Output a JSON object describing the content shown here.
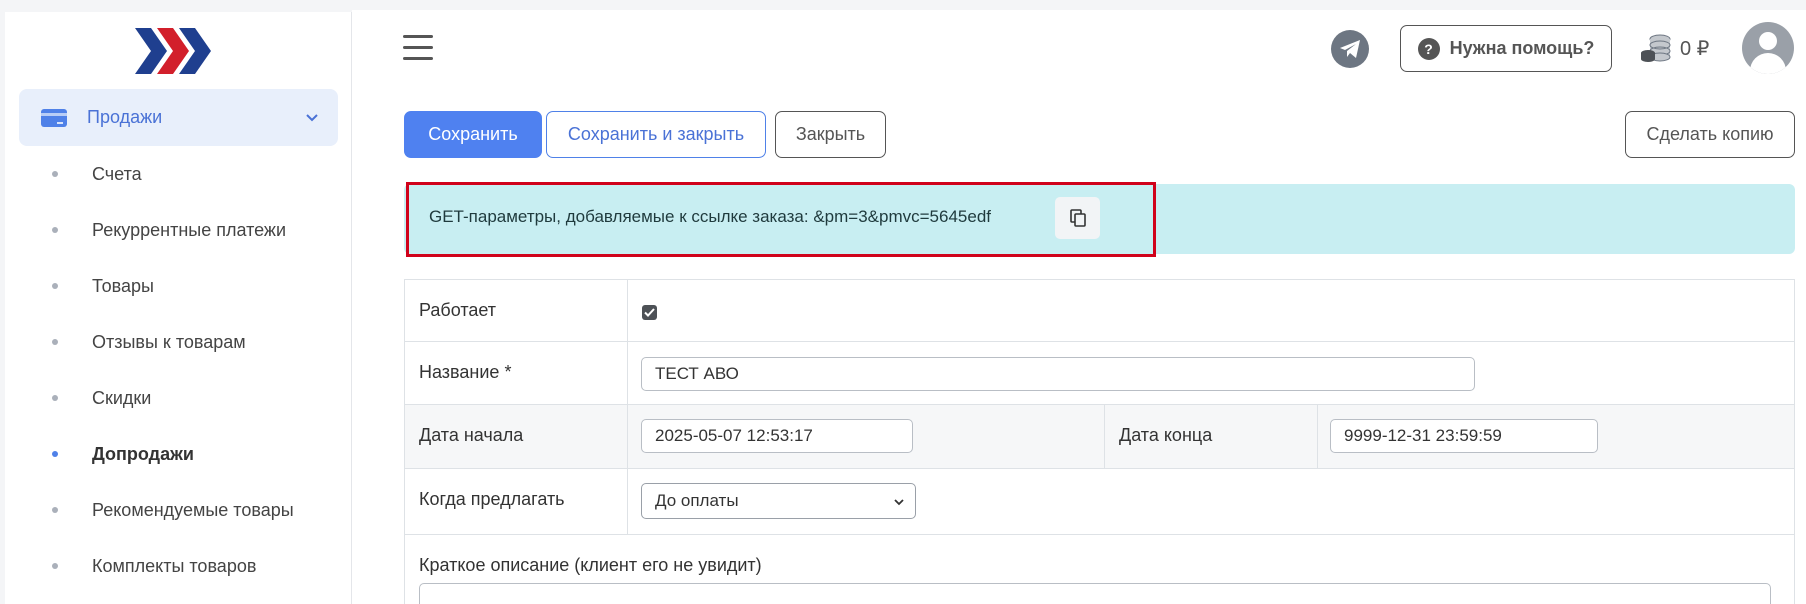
{
  "sidebar": {
    "group_label": "Продажи",
    "items": [
      {
        "label": "Счета",
        "active": false
      },
      {
        "label": "Рекуррентные платежи",
        "active": false
      },
      {
        "label": "Товары",
        "active": false
      },
      {
        "label": "Отзывы к товарам",
        "active": false
      },
      {
        "label": "Скидки",
        "active": false
      },
      {
        "label": "Допродажи",
        "active": true
      },
      {
        "label": "Рекомендуемые товары",
        "active": false
      },
      {
        "label": "Комплекты товаров",
        "active": false
      }
    ]
  },
  "header": {
    "help_label": "Нужна помощь?",
    "balance": "0 ₽"
  },
  "toolbar": {
    "save_label": "Сохранить",
    "save_close_label": "Сохранить и закрыть",
    "close_label": "Закрыть",
    "copy_label": "Сделать копию"
  },
  "info": {
    "text": "GET-параметры, добавляемые к ссылке заказа: &pm=3&pmvc=5645edf"
  },
  "form": {
    "active_label": "Работает",
    "active_checked": true,
    "name_label": "Название *",
    "name_value": "ТЕСТ АВО",
    "start_label": "Дата начала",
    "start_value": "2025-05-07 12:53:17",
    "end_label": "Дата конца",
    "end_value": "9999-12-31 23:59:59",
    "when_label": "Когда предлагать",
    "when_value": "До оплаты",
    "desc_label": "Краткое описание (клиент его не увидит)"
  },
  "colors": {
    "accent": "#4f81f0",
    "info_bg": "#c8eef2",
    "highlight": "#d0021b"
  }
}
